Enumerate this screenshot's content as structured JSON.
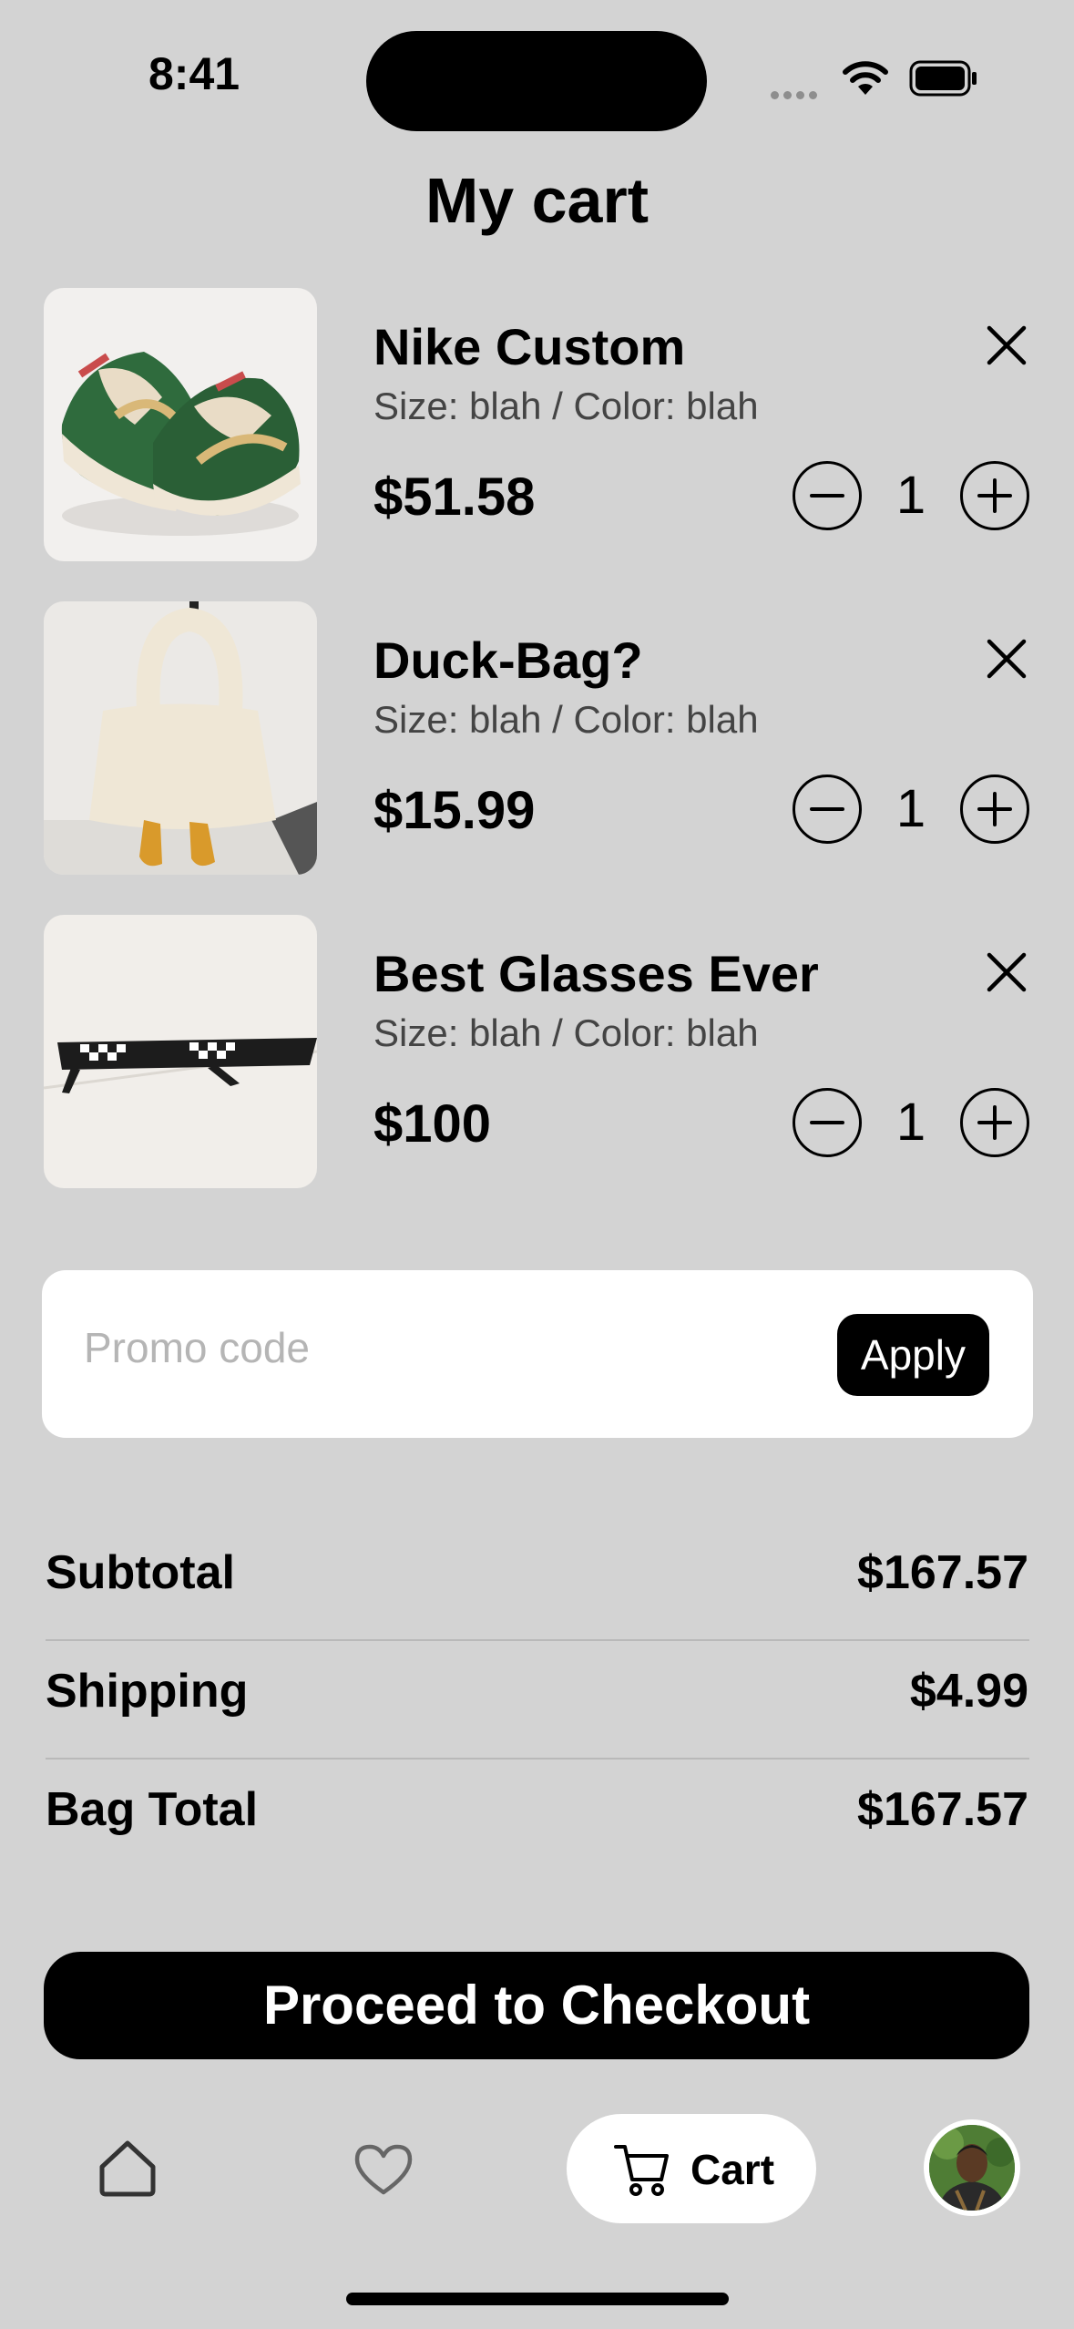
{
  "status_bar": {
    "time": "8:41"
  },
  "header": {
    "title": "My cart"
  },
  "items": [
    {
      "name": "Nike Custom",
      "meta": "Size: blah / Color: blah",
      "price": "$51.58",
      "quantity": "1",
      "image": "sneakers"
    },
    {
      "name": "Duck-Bag?",
      "meta": "Size: blah / Color: blah",
      "price": "$15.99",
      "quantity": "1",
      "image": "duck-bag"
    },
    {
      "name": "Best Glasses Ever",
      "meta": "Size: blah / Color: blah",
      "price": "$100",
      "quantity": "1",
      "image": "pixel-glasses"
    }
  ],
  "promo": {
    "placeholder": "Promo code",
    "value": "",
    "apply_label": "Apply"
  },
  "summary": [
    {
      "label": "Subtotal",
      "value": "$167.57"
    },
    {
      "label": "Shipping",
      "value": "$4.99"
    },
    {
      "label": "Bag Total",
      "value": "$167.57"
    }
  ],
  "checkout": {
    "label": "Proceed to Checkout"
  },
  "tab_bar": {
    "tabs": [
      {
        "icon": "home-icon"
      },
      {
        "icon": "heart-icon"
      },
      {
        "icon": "cart-icon",
        "label": "Cart",
        "active": true
      },
      {
        "icon": "avatar"
      }
    ]
  },
  "colors": {
    "background": "#d3d3d3",
    "primary": "#000000",
    "surface": "#ffffff",
    "muted": "#b5b5b5"
  }
}
